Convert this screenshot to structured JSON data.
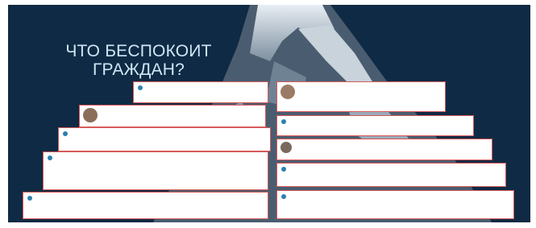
{
  "slide": {
    "title_line1": "ЧТО БЕСПОКОИТ",
    "title_line2": "ГРАЖДАН?",
    "colors": {
      "background": "#0f2a44",
      "title": "#cfe6f5",
      "card_border": "#d65a5a"
    }
  },
  "comments_left": [
    {
      "author": "",
      "date": "",
      "text": ""
    },
    {
      "author": "",
      "date": "",
      "text": ""
    },
    {
      "author": "",
      "date": "",
      "text": ""
    },
    {
      "author": "",
      "date": "",
      "text": ""
    },
    {
      "author": "",
      "date": "",
      "text": ""
    }
  ],
  "comments_right": [
    {
      "author": "",
      "date": "",
      "text": ""
    },
    {
      "author": "",
      "date": "",
      "text": ""
    },
    {
      "author": "",
      "date": "",
      "text": ""
    },
    {
      "author": "",
      "date": "",
      "text": ""
    },
    {
      "author": "",
      "date": "",
      "text": ""
    }
  ]
}
